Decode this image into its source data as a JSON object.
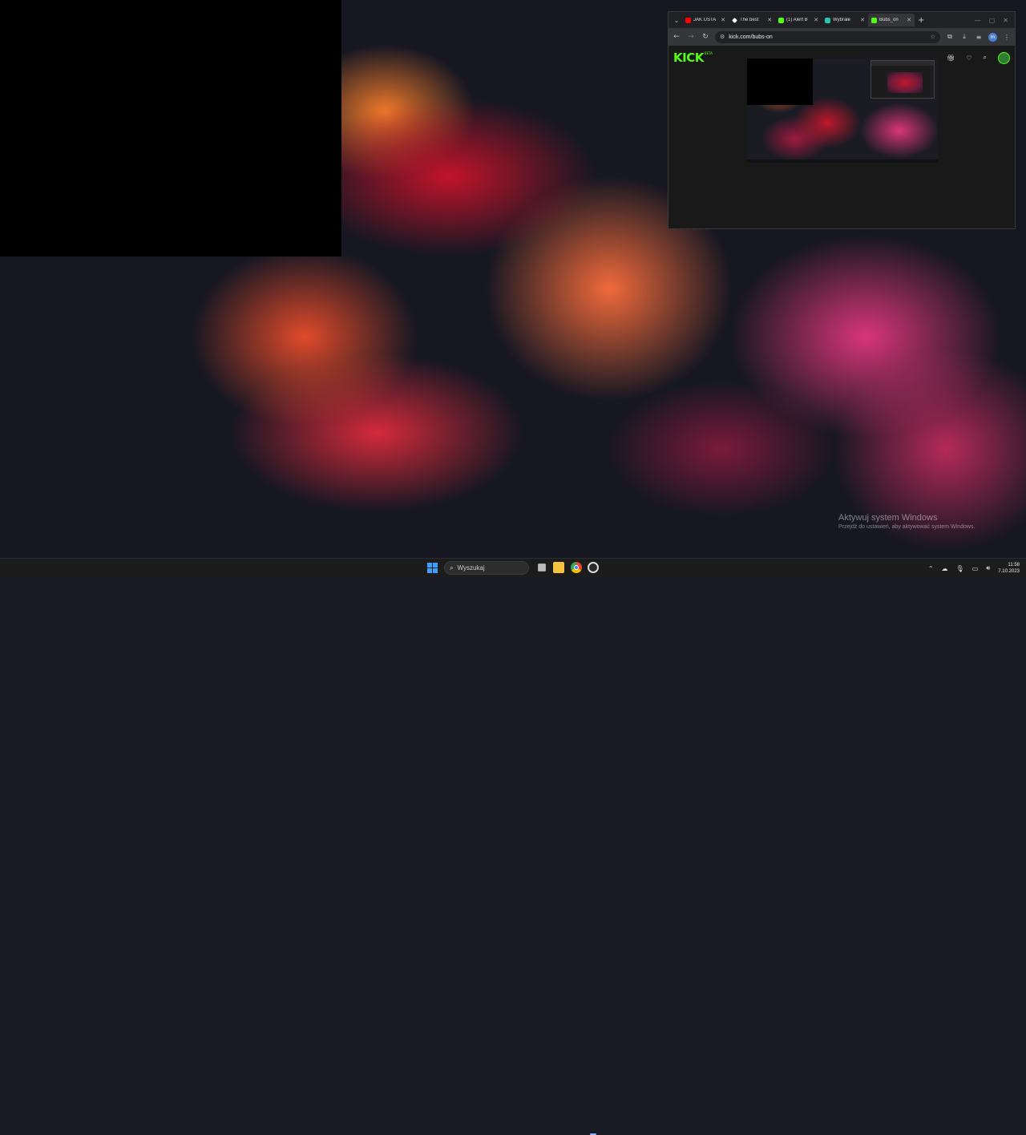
{
  "desktop": {
    "watermark_title": "Aktywuj system Windows",
    "watermark_subtitle": "Przejdź do ustawień, aby aktywować system Windows."
  },
  "browser": {
    "tabs": [
      {
        "title": "JAK USTA",
        "favicon_color": "#ff0000",
        "icon": "youtube-icon"
      },
      {
        "title": "The best",
        "favicon_color": "#ffffff",
        "icon": "diamond-icon"
      },
      {
        "title": "(1) Alert B",
        "favicon_color": "#53fc18",
        "icon": "kick-icon"
      },
      {
        "title": "Wybrałe",
        "favicon_color": "#29c4b0",
        "icon": "streamlabs-icon"
      },
      {
        "title": "Bubs_on",
        "favicon_color": "#53fc18",
        "icon": "kick-icon",
        "active": true
      }
    ],
    "url": "kick.com/bubs-on"
  },
  "kick": {
    "logo": "KICK",
    "beta": "BETA"
  },
  "taskbar": {
    "search_placeholder": "Wyszukaj",
    "time": "11:58",
    "date": "7.10.2023"
  }
}
